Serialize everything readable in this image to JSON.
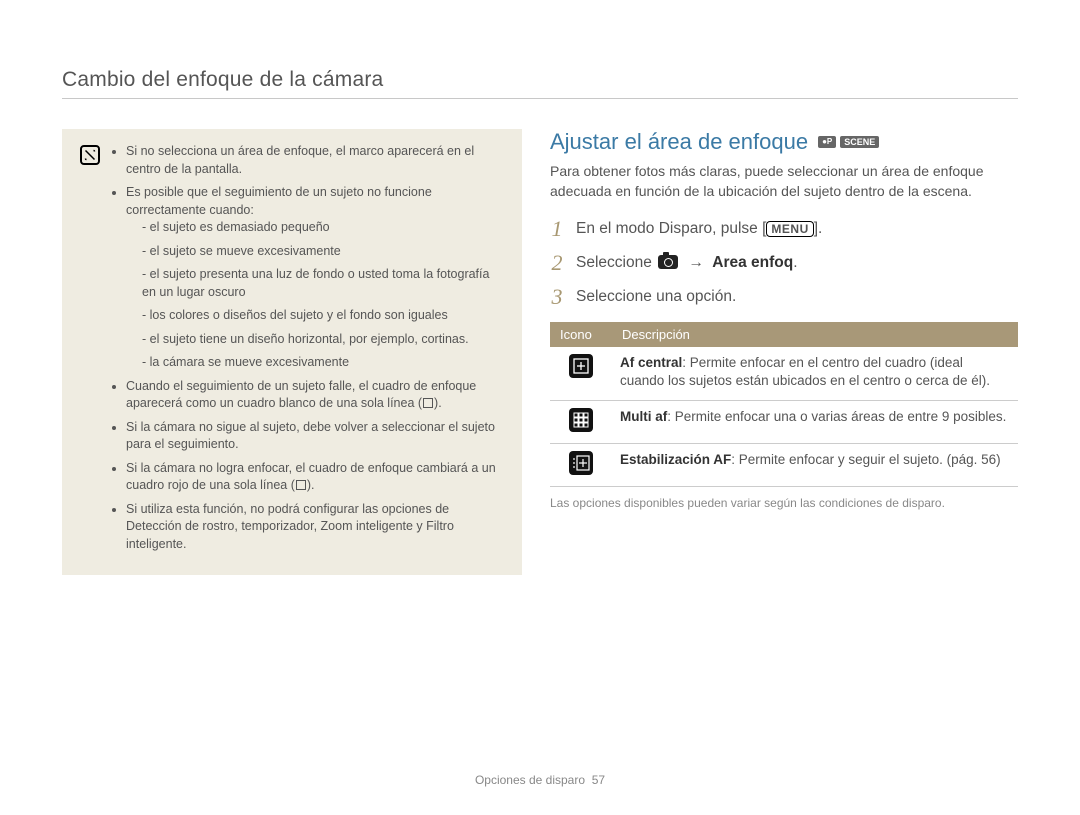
{
  "page_title": "Cambio del enfoque de la cámara",
  "footer": {
    "section": "Opciones de disparo",
    "page_num": "57"
  },
  "note": {
    "bullets": [
      "Si no selecciona un área de enfoque, el marco aparecerá en el centro de la pantalla.",
      "Es posible que el seguimiento de un sujeto no funcione correctamente cuando:",
      "Cuando el seguimiento de un sujeto falle, el cuadro de enfoque aparecerá como un cuadro blanco de una sola línea (",
      "Si la cámara no sigue al sujeto, debe volver a seleccionar el sujeto para el seguimiento.",
      "Si la cámara no logra enfocar, el cuadro de enfoque cambiará a un cuadro rojo de una sola línea (",
      "Si utiliza esta función, no podrá configurar las opciones de Detección de rostro, temporizador, Zoom inteligente y Filtro inteligente."
    ],
    "sub_dashes": [
      "el sujeto es demasiado pequeño",
      "el sujeto se mueve excesivamente",
      "el sujeto presenta una luz de fondo o usted toma la fotografía en un lugar oscuro",
      "los colores o diseños del sujeto y el fondo son iguales",
      "el sujeto tiene un diseño horizontal, por ejemplo, cortinas.",
      "la cámara se mueve excesivamente"
    ],
    "close_paren": ")."
  },
  "right": {
    "heading": "Ajustar el área de enfoque",
    "mode_badges": [
      "P",
      "SCENE"
    ],
    "intro": "Para obtener fotos más claras, puede seleccionar un área de enfoque adecuada en función de la ubicación del sujeto dentro de la escena.",
    "steps": {
      "s1_prefix": "En el modo Disparo, pulse [",
      "s1_menu": "MENU",
      "s1_suffix": "].",
      "s2_prefix": "Seleccione ",
      "s2_arrow": "→",
      "s2_bold": "Area enfoq",
      "s2_suffix": ".",
      "s3": "Seleccione una opción."
    },
    "table": {
      "head_icon": "Icono",
      "head_desc": "Descripción",
      "rows": [
        {
          "name_bold": "Af central",
          "rest": ": Permite enfocar en el centro del cuadro (ideal cuando los sujetos están ubicados en el centro o cerca de él)."
        },
        {
          "name_bold": "Multi af",
          "rest": ": Permite enfocar una o varias áreas de entre 9 posibles."
        },
        {
          "name_bold": "Estabilización AF",
          "rest": ": Permite enfocar y seguir el sujeto. (pág. 56)"
        }
      ]
    },
    "table_note": "Las opciones disponibles pueden variar según las condiciones de disparo."
  }
}
